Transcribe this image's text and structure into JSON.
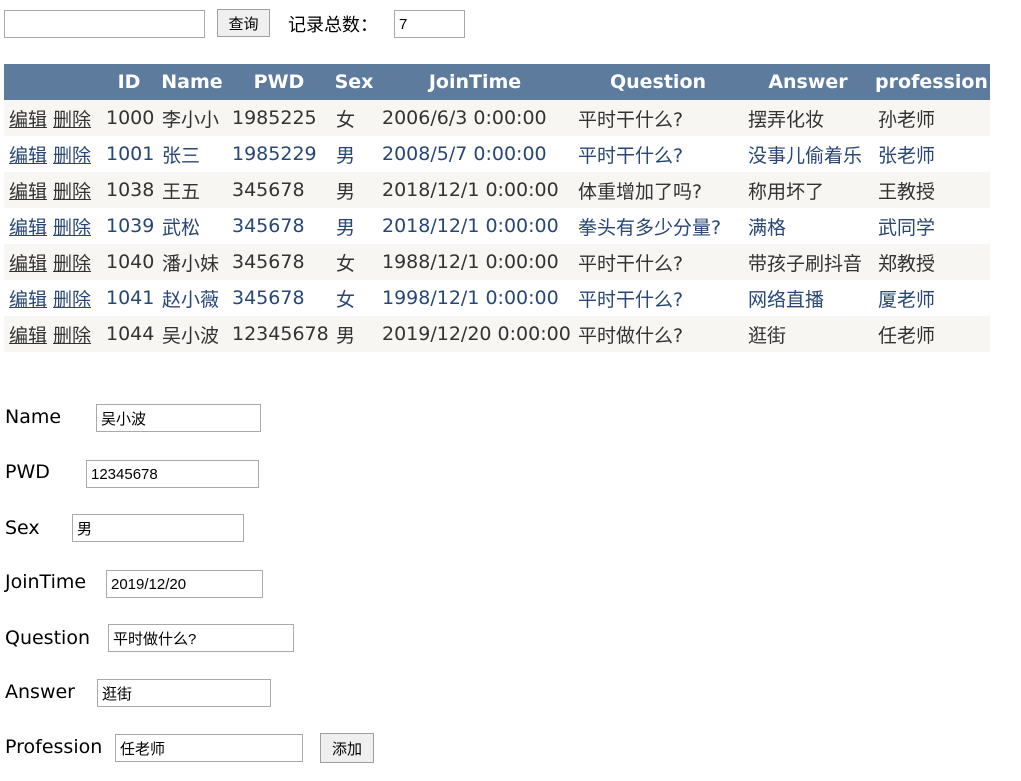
{
  "search": {
    "query": "",
    "button_label": "查询",
    "count_label": "记录总数：",
    "count_value": "7"
  },
  "table": {
    "headers": [
      "",
      "ID",
      "Name",
      "PWD",
      "Sex",
      "JoinTime",
      "Question",
      "Answer",
      "profession"
    ],
    "edit_label": "编辑",
    "delete_label": "删除",
    "rows": [
      {
        "id": "1000",
        "name": "李小小",
        "pwd": "1985225",
        "sex": "女",
        "join": "2006/6/3 0:00:00",
        "question": "平时干什么?",
        "answer": "摆弄化妆",
        "profession": "孙老师"
      },
      {
        "id": "1001",
        "name": "张三",
        "pwd": "1985229",
        "sex": "男",
        "join": "2008/5/7 0:00:00",
        "question": "平时干什么?",
        "answer": "没事儿偷着乐",
        "profession": "张老师"
      },
      {
        "id": "1038",
        "name": "王五",
        "pwd": "345678",
        "sex": "男",
        "join": "2018/12/1 0:00:00",
        "question": "体重增加了吗?",
        "answer": "称用坏了",
        "profession": "王教授"
      },
      {
        "id": "1039",
        "name": "武松",
        "pwd": "345678",
        "sex": "男",
        "join": "2018/12/1 0:00:00",
        "question": "拳头有多少分量?",
        "answer": "满格",
        "profession": "武同学"
      },
      {
        "id": "1040",
        "name": "潘小妹",
        "pwd": "345678",
        "sex": "女",
        "join": "1988/12/1 0:00:00",
        "question": "平时干什么?",
        "answer": "带孩子刷抖音",
        "profession": "郑教授"
      },
      {
        "id": "1041",
        "name": "赵小薇",
        "pwd": "345678",
        "sex": "女",
        "join": "1998/12/1 0:00:00",
        "question": "平时干什么?",
        "answer": "网络直播",
        "profession": "厦老师"
      },
      {
        "id": "1044",
        "name": "吴小波",
        "pwd": "12345678",
        "sex": "男",
        "join": "2019/12/20 0:00:00",
        "question": "平时做什么?",
        "answer": "逛街",
        "profession": "任老师"
      }
    ]
  },
  "form": {
    "name_label": "Name",
    "name_value": "吴小波",
    "pwd_label": "PWD",
    "pwd_value": "12345678",
    "sex_label": "Sex",
    "sex_value": "男",
    "join_label": "JoinTime",
    "join_value": "2019/12/20",
    "question_label": "Question",
    "question_value": "平时做什么?",
    "answer_label": "Answer",
    "answer_value": "逛街",
    "profession_label": "Profession",
    "profession_value": "任老师",
    "add_label": "添加"
  },
  "colors": {
    "header_bg": "#5d7b9d",
    "odd_row_bg": "#f7f6f3",
    "even_row_text": "#284775",
    "odd_row_text": "#333333"
  }
}
